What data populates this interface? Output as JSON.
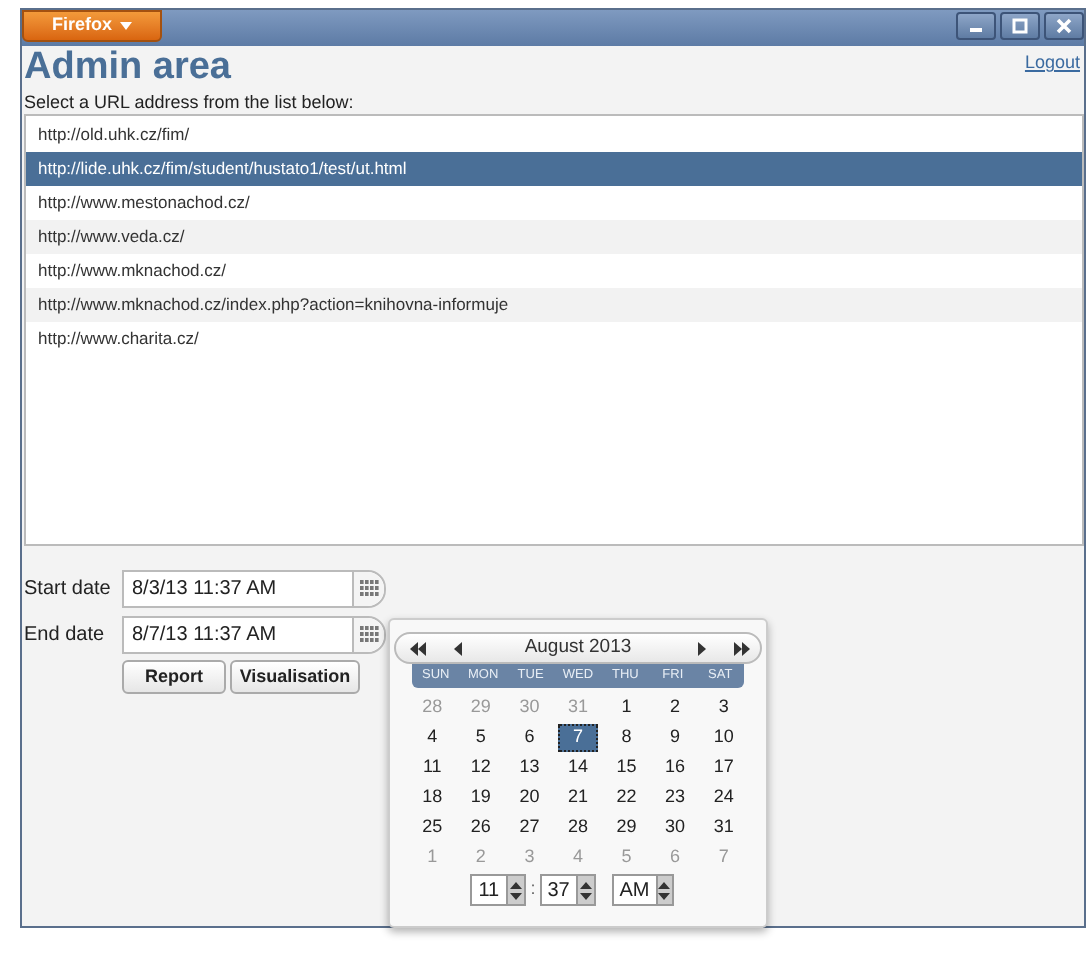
{
  "window": {
    "menu_button": "Firefox",
    "logout": "Logout"
  },
  "heading": "Admin area",
  "instruction": "Select a URL address from the list below:",
  "urls": [
    {
      "text": "http://old.uhk.cz/fim/",
      "selected": false
    },
    {
      "text": "http://lide.uhk.cz/fim/student/hustato1/test/ut.html",
      "selected": true
    },
    {
      "text": "http://www.mestonachod.cz/",
      "selected": false
    },
    {
      "text": "http://www.veda.cz/",
      "selected": false
    },
    {
      "text": "http://www.mknachod.cz/",
      "selected": false
    },
    {
      "text": "http://www.mknachod.cz/index.php?action=knihovna-informuje",
      "selected": false
    },
    {
      "text": "http://www.charita.cz/",
      "selected": false
    }
  ],
  "start_date": {
    "label": "Start date",
    "value": "8/3/13 11:37 AM"
  },
  "end_date": {
    "label": "End date",
    "value": "8/7/13 11:37 AM"
  },
  "buttons": [
    "Report",
    "Visualisation"
  ],
  "calendar": {
    "month": "August 2013",
    "weekdays": [
      "SUN",
      "MON",
      "TUE",
      "WED",
      "THU",
      "FRI",
      "SAT"
    ],
    "days": [
      {
        "text": "28",
        "other_month": true,
        "selected": false
      },
      {
        "text": "29",
        "other_month": true,
        "selected": false
      },
      {
        "text": "30",
        "other_month": true,
        "selected": false
      },
      {
        "text": "31",
        "other_month": true,
        "selected": false
      },
      {
        "text": "1",
        "other_month": false,
        "selected": false
      },
      {
        "text": "2",
        "other_month": false,
        "selected": false
      },
      {
        "text": "3",
        "other_month": false,
        "selected": false
      },
      {
        "text": "4",
        "other_month": false,
        "selected": false
      },
      {
        "text": "5",
        "other_month": false,
        "selected": false
      },
      {
        "text": "6",
        "other_month": false,
        "selected": false
      },
      {
        "text": "7",
        "other_month": false,
        "selected": true
      },
      {
        "text": "8",
        "other_month": false,
        "selected": false
      },
      {
        "text": "9",
        "other_month": false,
        "selected": false
      },
      {
        "text": "10",
        "other_month": false,
        "selected": false
      },
      {
        "text": "11",
        "other_month": false,
        "selected": false
      },
      {
        "text": "12",
        "other_month": false,
        "selected": false
      },
      {
        "text": "13",
        "other_month": false,
        "selected": false
      },
      {
        "text": "14",
        "other_month": false,
        "selected": false
      },
      {
        "text": "15",
        "other_month": false,
        "selected": false
      },
      {
        "text": "16",
        "other_month": false,
        "selected": false
      },
      {
        "text": "17",
        "other_month": false,
        "selected": false
      },
      {
        "text": "18",
        "other_month": false,
        "selected": false
      },
      {
        "text": "19",
        "other_month": false,
        "selected": false
      },
      {
        "text": "20",
        "other_month": false,
        "selected": false
      },
      {
        "text": "21",
        "other_month": false,
        "selected": false
      },
      {
        "text": "22",
        "other_month": false,
        "selected": false
      },
      {
        "text": "23",
        "other_month": false,
        "selected": false
      },
      {
        "text": "24",
        "other_month": false,
        "selected": false
      },
      {
        "text": "25",
        "other_month": false,
        "selected": false
      },
      {
        "text": "26",
        "other_month": false,
        "selected": false
      },
      {
        "text": "27",
        "other_month": false,
        "selected": false
      },
      {
        "text": "28",
        "other_month": false,
        "selected": false
      },
      {
        "text": "29",
        "other_month": false,
        "selected": false
      },
      {
        "text": "30",
        "other_month": false,
        "selected": false
      },
      {
        "text": "31",
        "other_month": false,
        "selected": false
      },
      {
        "text": "1",
        "other_month": true,
        "selected": false
      },
      {
        "text": "2",
        "other_month": true,
        "selected": false
      },
      {
        "text": "3",
        "other_month": true,
        "selected": false
      },
      {
        "text": "4",
        "other_month": true,
        "selected": false
      },
      {
        "text": "5",
        "other_month": true,
        "selected": false
      },
      {
        "text": "6",
        "other_month": true,
        "selected": false
      },
      {
        "text": "7",
        "other_month": true,
        "selected": false
      }
    ],
    "hour": "11",
    "separator": ":",
    "minute": "37",
    "ampm": "AM"
  }
}
